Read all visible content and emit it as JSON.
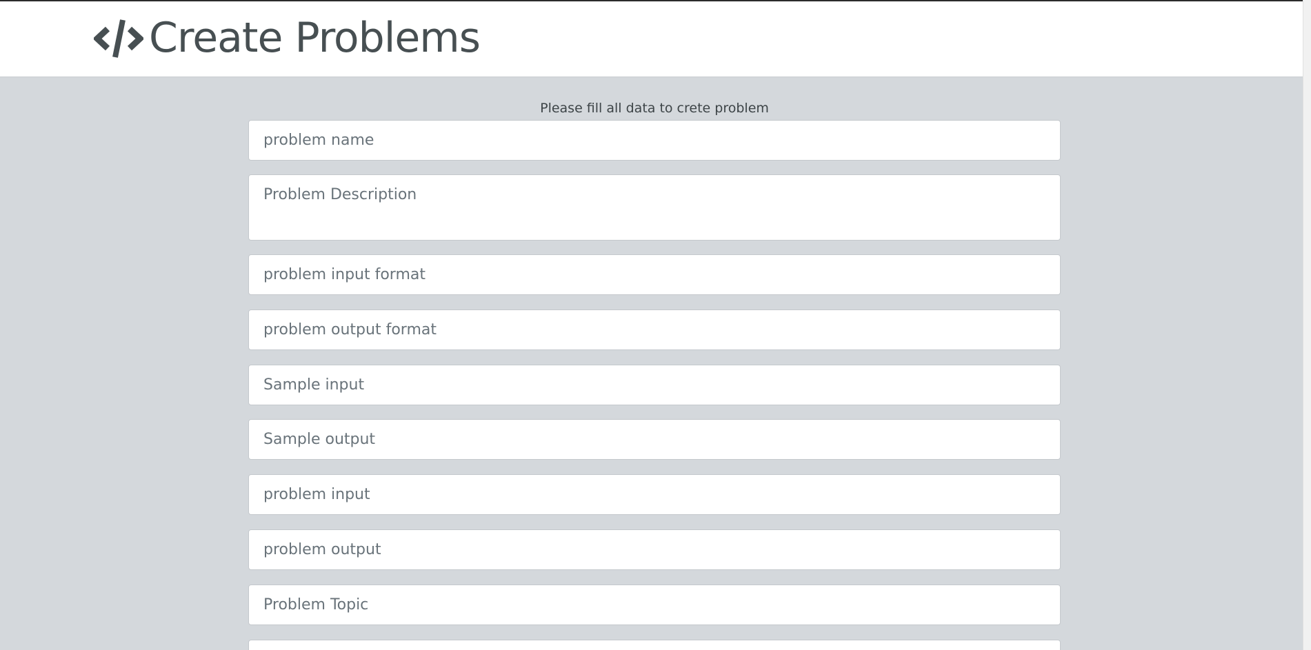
{
  "header": {
    "title": "Create Problems",
    "logo_icon": "code-brackets-icon"
  },
  "form": {
    "instructions": "Please fill all data to crete problem",
    "fields": {
      "problem_name": {
        "placeholder": "problem name",
        "value": ""
      },
      "problem_description": {
        "placeholder": "Problem Description",
        "value": ""
      },
      "input_format": {
        "placeholder": "problem input format",
        "value": ""
      },
      "output_format": {
        "placeholder": "problem output format",
        "value": ""
      },
      "sample_input": {
        "placeholder": "Sample input",
        "value": ""
      },
      "sample_output": {
        "placeholder": "Sample output",
        "value": ""
      },
      "problem_input": {
        "placeholder": "problem input",
        "value": ""
      },
      "problem_output": {
        "placeholder": "problem output",
        "value": ""
      },
      "problem_topic": {
        "placeholder": "Problem Topic",
        "value": ""
      },
      "next_field": {
        "placeholder": "",
        "value": ""
      }
    }
  },
  "colors": {
    "background": "#d4d8dc",
    "header_background": "#ffffff",
    "title_text": "#474f52",
    "placeholder_text": "#69737a"
  }
}
